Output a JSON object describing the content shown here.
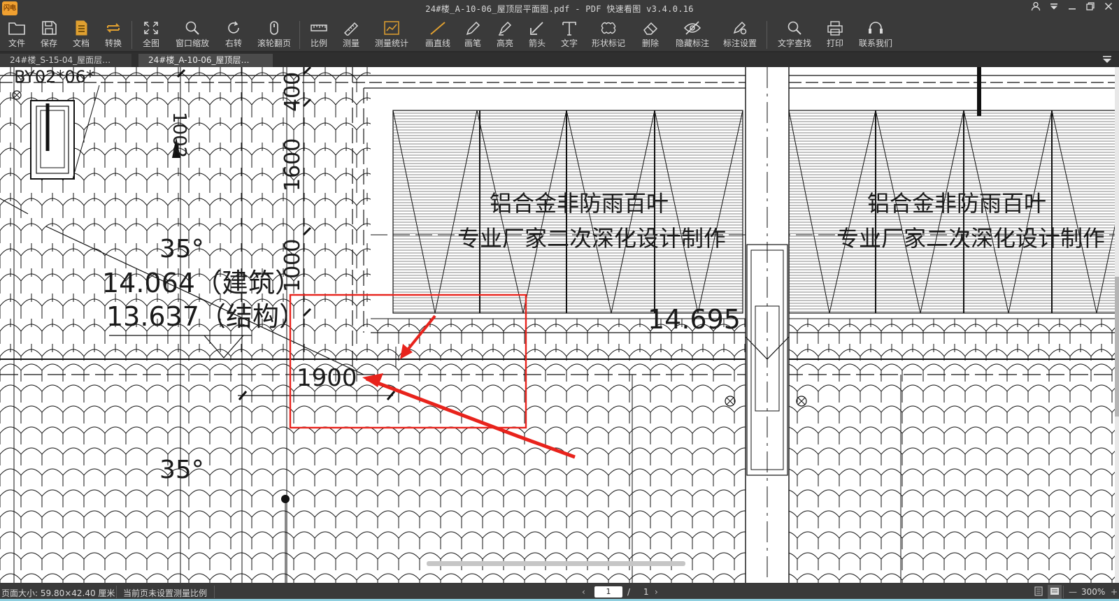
{
  "window": {
    "logo_text": "闪电",
    "title": "24#楼_A-10-06_屋顶层平面图.pdf - PDF 快速看图 v3.4.0.16"
  },
  "toolbar": {
    "items": [
      {
        "id": "file",
        "label": "文件",
        "icon": "folder-icon"
      },
      {
        "id": "save",
        "label": "保存",
        "icon": "save-icon"
      },
      {
        "id": "doc",
        "label": "文档",
        "icon": "document-icon"
      },
      {
        "id": "convert",
        "label": "转换",
        "icon": "convert-icon"
      },
      {
        "id": "fullview",
        "label": "全图",
        "icon": "fit-all-icon"
      },
      {
        "id": "zoomwin",
        "label": "窗口缩放",
        "icon": "zoom-window-icon"
      },
      {
        "id": "rotate",
        "label": "右转",
        "icon": "rotate-right-icon"
      },
      {
        "id": "wheel",
        "label": "滚轮翻页",
        "icon": "mouse-wheel-icon"
      },
      {
        "id": "scale",
        "label": "比例",
        "icon": "ruler-icon"
      },
      {
        "id": "measure",
        "label": "测量",
        "icon": "measure-icon"
      },
      {
        "id": "measure_stats",
        "label": "测量统计",
        "icon": "measure-stats-icon"
      },
      {
        "id": "line",
        "label": "画直线",
        "icon": "line-icon"
      },
      {
        "id": "pen",
        "label": "画笔",
        "icon": "pen-icon"
      },
      {
        "id": "highlight",
        "label": "高亮",
        "icon": "highlighter-icon"
      },
      {
        "id": "arrow",
        "label": "箭头",
        "icon": "arrow-icon"
      },
      {
        "id": "text",
        "label": "文字",
        "icon": "text-icon"
      },
      {
        "id": "shape",
        "label": "形状标记",
        "icon": "cloud-shape-icon"
      },
      {
        "id": "delete",
        "label": "删除",
        "icon": "eraser-icon"
      },
      {
        "id": "hide",
        "label": "隐藏标注",
        "icon": "eye-hide-icon"
      },
      {
        "id": "settings",
        "label": "标注设置",
        "icon": "annotation-settings-icon"
      },
      {
        "id": "find",
        "label": "文字查找",
        "icon": "search-icon"
      },
      {
        "id": "print",
        "label": "打印",
        "icon": "printer-icon"
      },
      {
        "id": "contact",
        "label": "联系我们",
        "icon": "headset-icon"
      }
    ]
  },
  "tabs": [
    {
      "label": "24#楼_S-15-04_屋面层…",
      "active": false
    },
    {
      "label": "24#楼_A-10-06_屋顶层…",
      "active": true
    }
  ],
  "drawing": {
    "louver_note_line1": "铝合金非防雨百叶",
    "louver_note_line2": "专业厂家二次深化设计制作",
    "angle_label": "35°",
    "elev_arch": "14.064（建筑）",
    "elev_struct": "13.637（结构）",
    "elev_right": "14.695",
    "dim_400": "400",
    "dim_1600": "1600",
    "dim_1000": "1000",
    "dim_1900": "1900",
    "dim_1002": "1002",
    "tag_by": "BY02*06*",
    "highlight_color": "#e8231c"
  },
  "status": {
    "page_size": "页面大小: 59.80×42.40 厘米",
    "scale_note": "当前页未设置测量比例",
    "current_page": "1",
    "page_sep": "/",
    "total_pages": "1",
    "zoom": "300%",
    "zoom_minus": "—",
    "zoom_plus": "+"
  }
}
